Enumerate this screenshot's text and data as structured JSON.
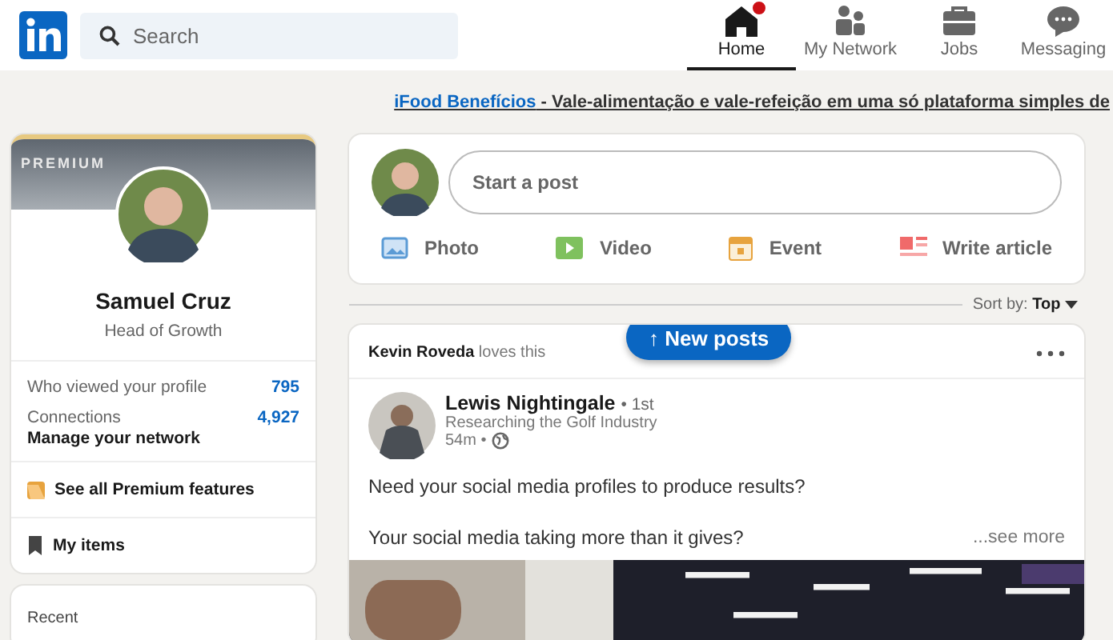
{
  "nav": {
    "search": {
      "placeholder": "Search"
    },
    "items": [
      {
        "kind": "home",
        "label": "Home",
        "selected": true,
        "notification": true
      },
      {
        "kind": "network",
        "label": "My Network",
        "selected": false,
        "notification": false
      },
      {
        "kind": "jobs",
        "label": "Jobs",
        "selected": false,
        "notification": false
      },
      {
        "kind": "messaging",
        "label": "Messaging",
        "selected": false,
        "notification": false
      }
    ]
  },
  "ad": {
    "link": "iFood Benefícios",
    "text": "- Vale-alimentação e vale-refeição em uma só plataforma simples de"
  },
  "profile": {
    "badge": "PREMIUM",
    "name": "Samuel Cruz",
    "headline": "Head of Growth",
    "stats": [
      {
        "label": "Who viewed your profile",
        "value": "795"
      },
      {
        "label": "Connections",
        "value": "4,927",
        "sub": "Manage your network"
      }
    ],
    "links": [
      {
        "kind": "premium",
        "label": "See all Premium features"
      },
      {
        "kind": "bookmark",
        "label": "My items"
      }
    ]
  },
  "recent": {
    "title": "Recent"
  },
  "composer": {
    "placeholder": "Start a post",
    "actions": [
      {
        "label": "Photo"
      },
      {
        "kind": "video",
        "label": "Video"
      },
      {
        "kind": "event",
        "label": "Event"
      },
      {
        "kind": "article",
        "label": "Write article"
      }
    ]
  },
  "sort": {
    "label": "Sort by:",
    "value": "Top"
  },
  "new_posts": "↑ New posts",
  "post": {
    "actor": "Kevin Roveda",
    "action": "loves this",
    "author": "Lewis Nightingale",
    "degree": "• 1st",
    "headline": "Researching the Golf Industry",
    "time": "54m •",
    "lines": [
      "Need your social media profiles to produce results?",
      "Your social media taking more than it gives?"
    ],
    "see_more": "...see more"
  }
}
